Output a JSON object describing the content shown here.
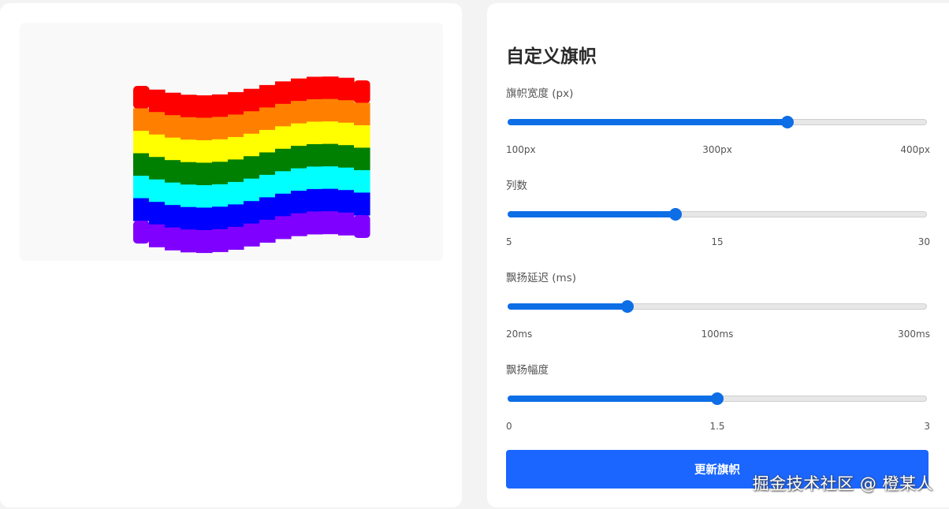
{
  "flag": {
    "stripe_colors": [
      "#ff0000",
      "#ff8000",
      "#ffff00",
      "#008000",
      "#00ffff",
      "#0000ff",
      "#8000ff"
    ],
    "columns": 15,
    "amplitude": 1.5
  },
  "panel": {
    "title": "自定义旗帜",
    "controls": [
      {
        "label": "旗帜宽度 (px)",
        "value": 300,
        "min": 100,
        "max": 400,
        "tick_min": "100px",
        "tick_mid": "300px",
        "tick_max": "400px"
      },
      {
        "label": "列数",
        "value": 15,
        "min": 5,
        "max": 30,
        "tick_min": "5",
        "tick_mid": "15",
        "tick_max": "30"
      },
      {
        "label": "飘扬延迟 (ms)",
        "value": 100,
        "min": 20,
        "max": 300,
        "tick_min": "20ms",
        "tick_mid": "100ms",
        "tick_max": "300ms"
      },
      {
        "label": "飘扬幅度",
        "value": 1.5,
        "min": 0,
        "max": 3,
        "tick_min": "0",
        "tick_mid": "1.5",
        "tick_max": "3"
      }
    ],
    "submit_label": "更新旗帜"
  },
  "watermark": "掘金技术社区 @ 橙某人",
  "colors": {
    "accent": "#0d6ee6",
    "button": "#1a66ff"
  }
}
